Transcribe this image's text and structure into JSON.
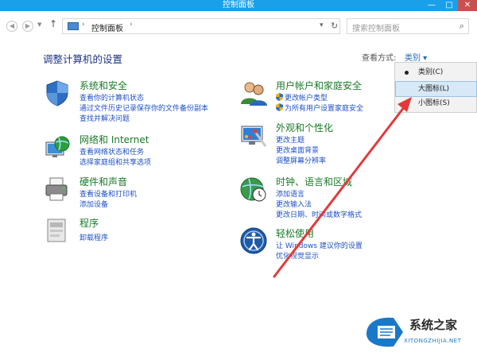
{
  "window": {
    "title": "控制面板",
    "min_glyph": "—",
    "max_glyph": "□",
    "close_glyph": "✕"
  },
  "address": {
    "path": "控制面板",
    "search_placeholder": "搜索控制面板"
  },
  "heading": "调整计算机的设置",
  "view": {
    "label": "查看方式:",
    "value": "类别 ▾"
  },
  "categories": [
    {
      "title": "系统和安全",
      "links": [
        "查看你的计算机状态",
        "通过文件历史记录保存你的文件备份副本",
        "查找并解决问题"
      ]
    },
    {
      "title": "网络和 Internet",
      "links": [
        "查看网络状态和任务",
        "选择家庭组和共享选项"
      ]
    },
    {
      "title": "硬件和声音",
      "links": [
        "查看设备和打印机",
        "添加设备"
      ]
    },
    {
      "title": "程序",
      "links": [
        "卸载程序"
      ]
    },
    {
      "title": "用户帐户和家庭安全",
      "links": [
        "更改帐户类型",
        "为所有用户设置家庭安全"
      ]
    },
    {
      "title": "外观和个性化",
      "links": [
        "更改主题",
        "更改桌面背景",
        "调整屏幕分辨率"
      ]
    },
    {
      "title": "时钟、语言和区域",
      "links": [
        "添加语言",
        "更改输入法",
        "更改日期、时间或数字格式"
      ]
    },
    {
      "title": "轻松使用",
      "links": [
        "让 Windows 建议你的设置",
        "优化视觉显示"
      ]
    }
  ],
  "view_menu": {
    "items": [
      "类别(C)",
      "大图标(L)",
      "小图标(S)"
    ],
    "selected": "类别(C)",
    "highlighted": "大图标(L)"
  },
  "watermark": {
    "text": "系统之家",
    "url": "XITONGZHIJIA.NET"
  },
  "colors": {
    "titlebar": "#1aa0e8",
    "category_title": "#1a7a2a",
    "link": "#1e50c8",
    "heading": "#1e3287",
    "arrow": "#e23a3a"
  }
}
